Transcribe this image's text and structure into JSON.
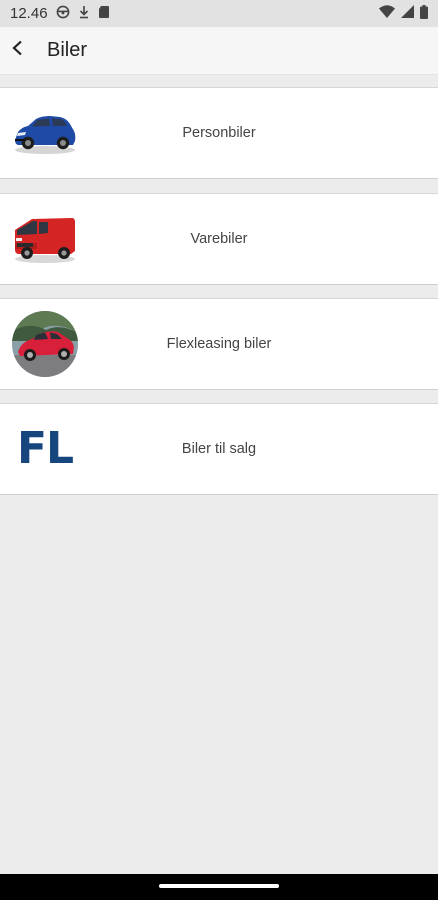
{
  "status_bar": {
    "time": "12.46",
    "icons": [
      "steering-wheel-icon",
      "download-icon",
      "sd-card-icon",
      "wifi-icon",
      "signal-icon",
      "battery-icon"
    ]
  },
  "app_bar": {
    "back_icon": "arrow-back-icon",
    "title": "Biler"
  },
  "items": [
    {
      "label": "Personbiler",
      "icon": "blue-suv-image"
    },
    {
      "label": "Varebiler",
      "icon": "red-van-image"
    },
    {
      "label": "Flexleasing biler",
      "icon": "red-sports-car-image"
    },
    {
      "label": "Biler til salg",
      "logo_text": "FL"
    }
  ],
  "colors": {
    "background": "#ececec",
    "card": "#ffffff",
    "fl_logo": "#17467e"
  }
}
